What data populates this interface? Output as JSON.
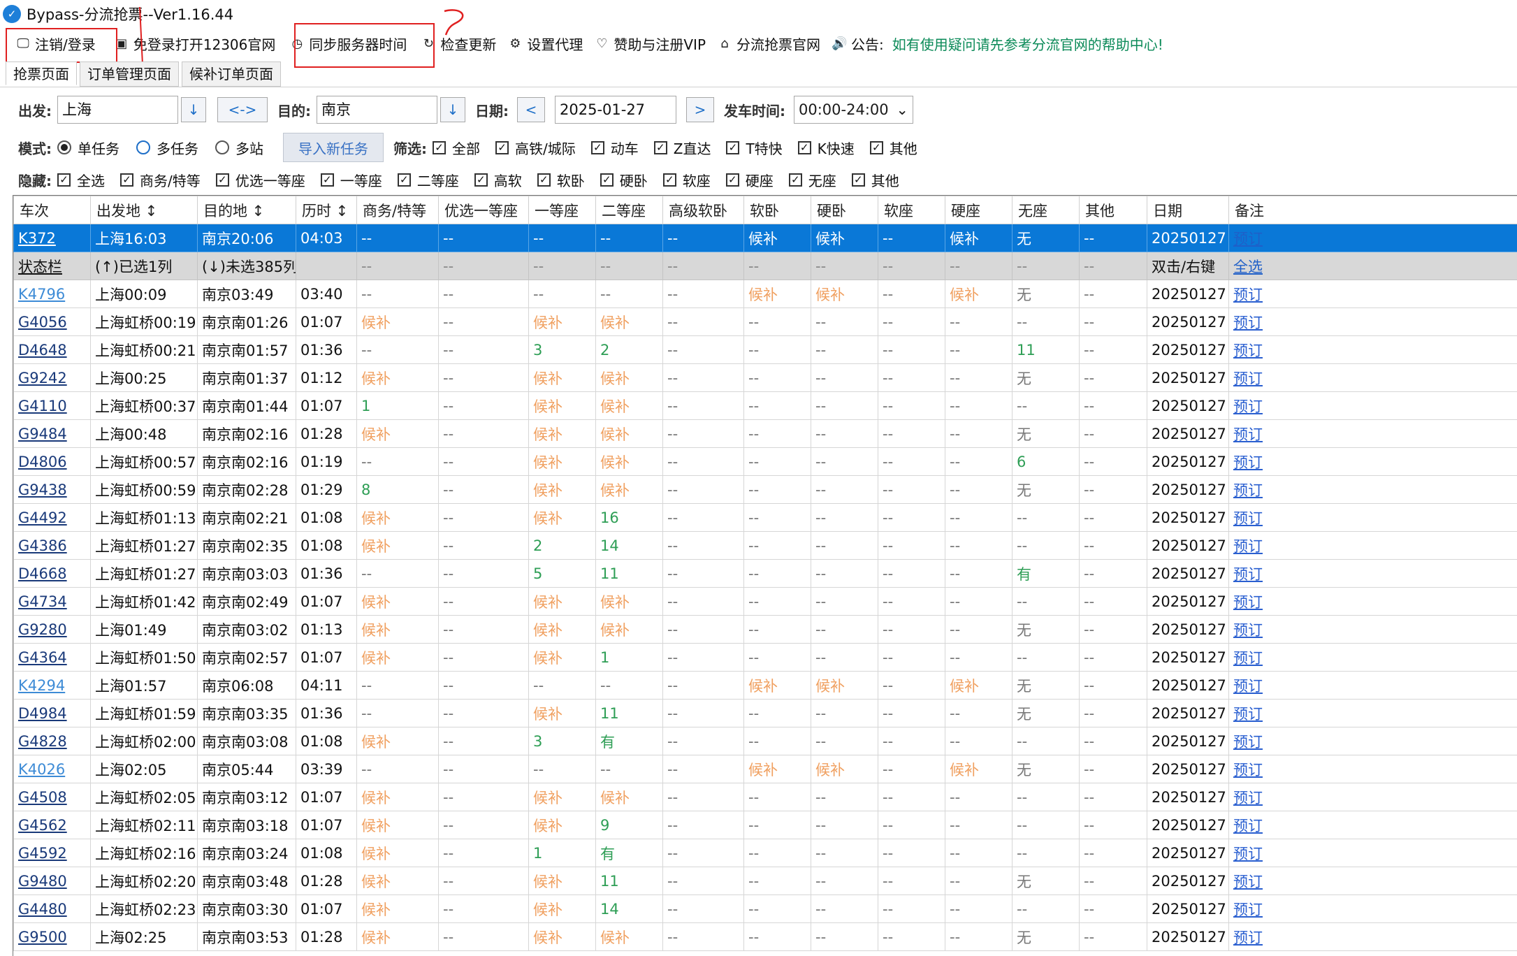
{
  "window": {
    "title": "Bypass-分流抢票--Ver1.16.44"
  },
  "toolbar": [
    {
      "icon": "monitor-icon",
      "glyph": "🖵",
      "label": "注销/登录"
    },
    {
      "icon": "browser-window-icon",
      "glyph": "▣",
      "label": "免登录打开12306官网"
    },
    {
      "icon": "clock-icon",
      "glyph": "◷",
      "label": "同步服务器时间"
    },
    {
      "icon": "refresh-icon",
      "glyph": "↻",
      "label": "检查更新"
    },
    {
      "icon": "gear-icon",
      "glyph": "⚙",
      "label": "设置代理"
    },
    {
      "icon": "heart-icon",
      "glyph": "♡",
      "label": "赞助与注册VIP"
    },
    {
      "icon": "home-icon",
      "glyph": "⌂",
      "label": "分流抢票官网"
    }
  ],
  "notice": {
    "icon": "speaker-icon",
    "glyph": "🔊",
    "label": "公告:",
    "text": "如有使用疑问请先参考分流官网的帮助中心!"
  },
  "tabs": [
    "抢票页面",
    "订单管理页面",
    "候补订单页面"
  ],
  "filters": {
    "from_label": "出发:",
    "from_value": "上海",
    "down_arrow": "↓",
    "swap_label": "<->",
    "to_label": "目的:",
    "to_value": "南京",
    "date_label": "日期:",
    "prev_label": "<",
    "date_value": "2025-01-27",
    "next_label": ">",
    "time_label": "发车时间:",
    "time_value": "00:00-24:00",
    "time_arrow": "⌄",
    "mode_label": "模式:",
    "modes": [
      "单任务",
      "多任务",
      "多站"
    ],
    "import_label": "导入新任务",
    "filter_label": "筛选:",
    "filter_types": [
      "全部",
      "高铁/城际",
      "动车",
      "Z直达",
      "T特快",
      "K快速",
      "其他"
    ],
    "hide_label": "隐藏:",
    "hide_seats": [
      "全选",
      "商务/特等",
      "优选一等座",
      "一等座",
      "二等座",
      "高软",
      "软卧",
      "硬卧",
      "软座",
      "硬座",
      "无座",
      "其他"
    ],
    "check_mark": "✓"
  },
  "table": {
    "headers": [
      "车次",
      "出发地 ↕",
      "目的地 ↕",
      "历时 ↕",
      "商务/特等",
      "优选一等座",
      "一等座",
      "二等座",
      "高级软卧",
      "软卧",
      "硬卧",
      "软座",
      "硬座",
      "无座",
      "其他",
      "日期",
      "备注"
    ],
    "selected_row": [
      "K372",
      "上海16:03",
      "南京20:06",
      "04:03",
      "--",
      "--",
      "--",
      "--",
      "--",
      "候补",
      "候补",
      "--",
      "候补",
      "无",
      "--",
      "20250127",
      "预订"
    ],
    "status_row": [
      "状态栏",
      "(↑)已选1列",
      "(↓)未选385列",
      "",
      "--",
      "--",
      "--",
      "--",
      "--",
      "--",
      "--",
      "--",
      "--",
      "--",
      "--",
      "双击/右键",
      "全选"
    ],
    "rows": [
      [
        "K4796",
        "上海00:09",
        "南京03:49",
        "03:40",
        "--",
        "--",
        "--",
        "--",
        "--",
        "候补",
        "候补",
        "--",
        "候补",
        "无",
        "--",
        "20250127",
        "预订"
      ],
      [
        "G4056",
        "上海虹桥00:19",
        "南京南01:26",
        "01:07",
        "候补",
        "--",
        "候补",
        "候补",
        "--",
        "--",
        "--",
        "--",
        "--",
        "--",
        "--",
        "20250127",
        "预订"
      ],
      [
        "D4648",
        "上海虹桥00:21",
        "南京南01:57",
        "01:36",
        "--",
        "--",
        "3",
        "2",
        "--",
        "--",
        "--",
        "--",
        "--",
        "11",
        "--",
        "20250127",
        "预订"
      ],
      [
        "G9242",
        "上海00:25",
        "南京南01:37",
        "01:12",
        "候补",
        "--",
        "候补",
        "候补",
        "--",
        "--",
        "--",
        "--",
        "--",
        "无",
        "--",
        "20250127",
        "预订"
      ],
      [
        "G4110",
        "上海虹桥00:37",
        "南京南01:44",
        "01:07",
        "1",
        "--",
        "候补",
        "候补",
        "--",
        "--",
        "--",
        "--",
        "--",
        "--",
        "--",
        "20250127",
        "预订"
      ],
      [
        "G9484",
        "上海00:48",
        "南京南02:16",
        "01:28",
        "候补",
        "--",
        "候补",
        "候补",
        "--",
        "--",
        "--",
        "--",
        "--",
        "无",
        "--",
        "20250127",
        "预订"
      ],
      [
        "D4806",
        "上海虹桥00:57",
        "南京南02:16",
        "01:19",
        "--",
        "--",
        "候补",
        "候补",
        "--",
        "--",
        "--",
        "--",
        "--",
        "6",
        "--",
        "20250127",
        "预订"
      ],
      [
        "G9438",
        "上海虹桥00:59",
        "南京南02:28",
        "01:29",
        "8",
        "--",
        "候补",
        "候补",
        "--",
        "--",
        "--",
        "--",
        "--",
        "无",
        "--",
        "20250127",
        "预订"
      ],
      [
        "G4492",
        "上海虹桥01:13",
        "南京南02:21",
        "01:08",
        "候补",
        "--",
        "候补",
        "16",
        "--",
        "--",
        "--",
        "--",
        "--",
        "--",
        "--",
        "20250127",
        "预订"
      ],
      [
        "G4386",
        "上海虹桥01:27",
        "南京南02:35",
        "01:08",
        "候补",
        "--",
        "2",
        "14",
        "--",
        "--",
        "--",
        "--",
        "--",
        "--",
        "--",
        "20250127",
        "预订"
      ],
      [
        "D4668",
        "上海虹桥01:27",
        "南京南03:03",
        "01:36",
        "--",
        "--",
        "5",
        "11",
        "--",
        "--",
        "--",
        "--",
        "--",
        "有",
        "--",
        "20250127",
        "预订"
      ],
      [
        "G4734",
        "上海虹桥01:42",
        "南京南02:49",
        "01:07",
        "候补",
        "--",
        "候补",
        "候补",
        "--",
        "--",
        "--",
        "--",
        "--",
        "--",
        "--",
        "20250127",
        "预订"
      ],
      [
        "G9280",
        "上海01:49",
        "南京南03:02",
        "01:13",
        "候补",
        "--",
        "候补",
        "候补",
        "--",
        "--",
        "--",
        "--",
        "--",
        "无",
        "--",
        "20250127",
        "预订"
      ],
      [
        "G4364",
        "上海虹桥01:50",
        "南京南02:57",
        "01:07",
        "候补",
        "--",
        "候补",
        "1",
        "--",
        "--",
        "--",
        "--",
        "--",
        "--",
        "--",
        "20250127",
        "预订"
      ],
      [
        "K4294",
        "上海01:57",
        "南京06:08",
        "04:11",
        "--",
        "--",
        "--",
        "--",
        "--",
        "候补",
        "候补",
        "--",
        "候补",
        "无",
        "--",
        "20250127",
        "预订"
      ],
      [
        "D4984",
        "上海虹桥01:59",
        "南京南03:35",
        "01:36",
        "--",
        "--",
        "候补",
        "11",
        "--",
        "--",
        "--",
        "--",
        "--",
        "无",
        "--",
        "20250127",
        "预订"
      ],
      [
        "G4828",
        "上海虹桥02:00",
        "南京南03:08",
        "01:08",
        "候补",
        "--",
        "3",
        "有",
        "--",
        "--",
        "--",
        "--",
        "--",
        "--",
        "--",
        "20250127",
        "预订"
      ],
      [
        "K4026",
        "上海02:05",
        "南京05:44",
        "03:39",
        "--",
        "--",
        "--",
        "--",
        "--",
        "候补",
        "候补",
        "--",
        "候补",
        "无",
        "--",
        "20250127",
        "预订"
      ],
      [
        "G4508",
        "上海虹桥02:05",
        "南京南03:12",
        "01:07",
        "候补",
        "--",
        "候补",
        "候补",
        "--",
        "--",
        "--",
        "--",
        "--",
        "--",
        "--",
        "20250127",
        "预订"
      ],
      [
        "G4562",
        "上海虹桥02:11",
        "南京南03:18",
        "01:07",
        "候补",
        "--",
        "候补",
        "9",
        "--",
        "--",
        "--",
        "--",
        "--",
        "--",
        "--",
        "20250127",
        "预订"
      ],
      [
        "G4592",
        "上海虹桥02:16",
        "南京南03:24",
        "01:08",
        "候补",
        "--",
        "1",
        "有",
        "--",
        "--",
        "--",
        "--",
        "--",
        "--",
        "--",
        "20250127",
        "预订"
      ],
      [
        "G9480",
        "上海虹桥02:20",
        "南京南03:48",
        "01:28",
        "候补",
        "--",
        "候补",
        "11",
        "--",
        "--",
        "--",
        "--",
        "--",
        "无",
        "--",
        "20250127",
        "预订"
      ],
      [
        "G4480",
        "上海虹桥02:23",
        "南京南03:30",
        "01:07",
        "候补",
        "--",
        "候补",
        "14",
        "--",
        "--",
        "--",
        "--",
        "--",
        "--",
        "--",
        "20250127",
        "预订"
      ],
      [
        "G9500",
        "上海02:25",
        "南京南03:53",
        "01:28",
        "候补",
        "--",
        "候补",
        "候补",
        "--",
        "--",
        "--",
        "--",
        "--",
        "无",
        "--",
        "20250127",
        "预订"
      ]
    ]
  },
  "colors": {
    "selected_row": "#0a78d7",
    "status_row": "#d8d8d8",
    "waitlist_text": "#f0a060",
    "available_text": "#2e9e55",
    "notice_text": "#0b8a58",
    "annotation_red": "#e02020"
  }
}
